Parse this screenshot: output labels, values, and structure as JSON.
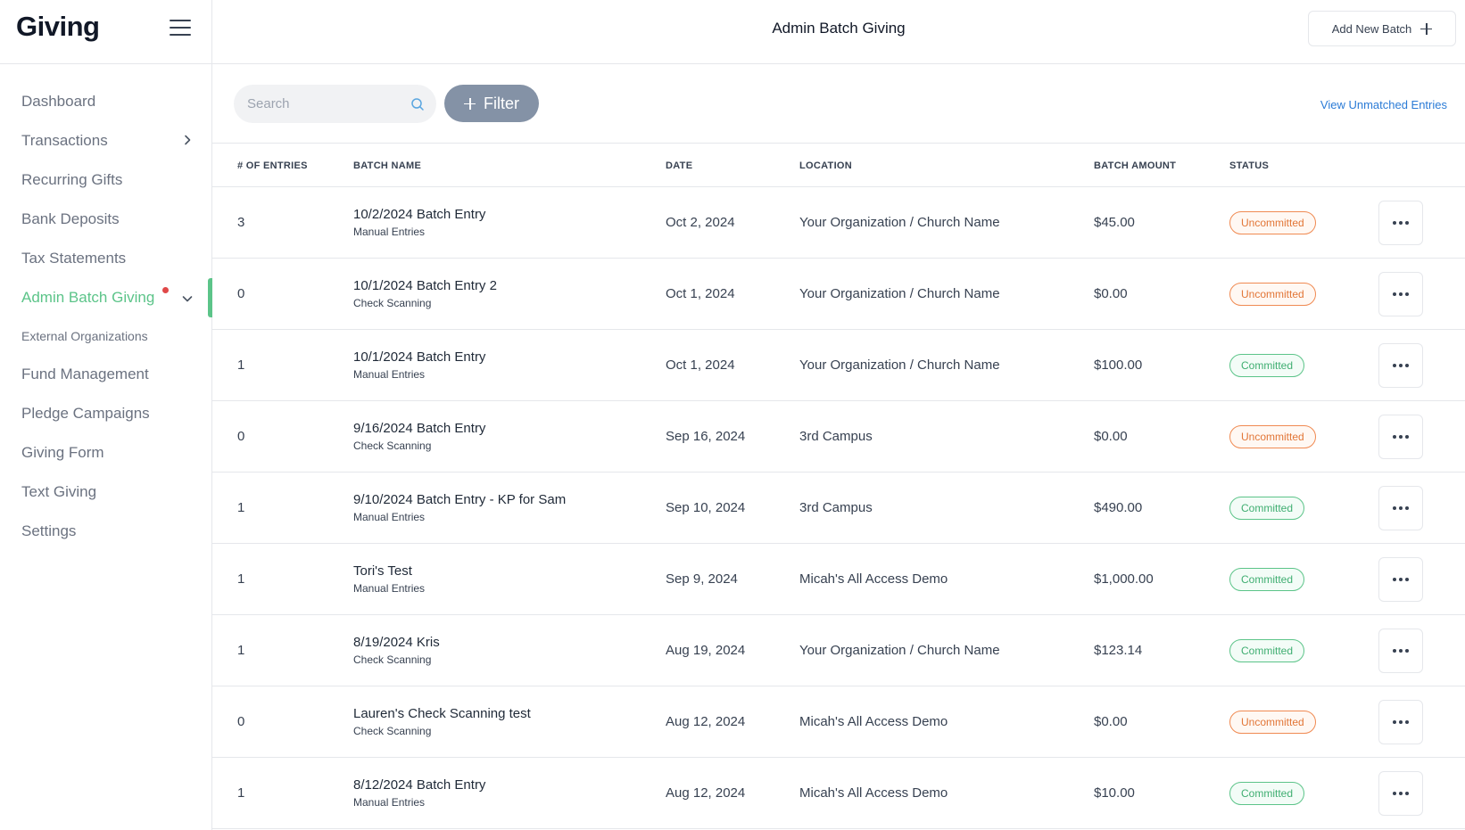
{
  "sidebar": {
    "brand": "Giving",
    "items": [
      {
        "label": "Dashboard"
      },
      {
        "label": "Transactions"
      },
      {
        "label": "Recurring Gifts"
      },
      {
        "label": "Bank Deposits"
      },
      {
        "label": "Tax Statements"
      },
      {
        "label": "Admin Batch Giving"
      },
      {
        "label": "External Organizations"
      },
      {
        "label": "Fund Management"
      },
      {
        "label": "Pledge Campaigns"
      },
      {
        "label": "Giving Form"
      },
      {
        "label": "Text Giving"
      },
      {
        "label": "Settings"
      }
    ]
  },
  "header": {
    "title": "Admin Batch Giving",
    "add_button": "Add New Batch"
  },
  "toolbar": {
    "search_placeholder": "Search",
    "filter_label": "Filter",
    "unmatched_link": "View Unmatched Entries"
  },
  "table": {
    "columns": [
      "# OF ENTRIES",
      "BATCH NAME",
      "DATE",
      "LOCATION",
      "BATCH AMOUNT",
      "STATUS"
    ],
    "rows": [
      {
        "entries": "3",
        "name": "10/2/2024 Batch Entry",
        "type": "Manual Entries",
        "date": "Oct 2, 2024",
        "location": "Your Organization / Church Name",
        "amount": "$45.00",
        "status": "Uncommitted"
      },
      {
        "entries": "0",
        "name": "10/1/2024 Batch Entry 2",
        "type": "Check Scanning",
        "date": "Oct 1, 2024",
        "location": "Your Organization / Church Name",
        "amount": "$0.00",
        "status": "Uncommitted"
      },
      {
        "entries": "1",
        "name": "10/1/2024 Batch Entry",
        "type": "Manual Entries",
        "date": "Oct 1, 2024",
        "location": "Your Organization / Church Name",
        "amount": "$100.00",
        "status": "Committed"
      },
      {
        "entries": "0",
        "name": "9/16/2024 Batch Entry",
        "type": "Check Scanning",
        "date": "Sep 16, 2024",
        "location": "3rd Campus",
        "amount": "$0.00",
        "status": "Uncommitted"
      },
      {
        "entries": "1",
        "name": "9/10/2024 Batch Entry - KP for Sam",
        "type": "Manual Entries",
        "date": "Sep 10, 2024",
        "location": "3rd Campus",
        "amount": "$490.00",
        "status": "Committed"
      },
      {
        "entries": "1",
        "name": "Tori's Test",
        "type": "Manual Entries",
        "date": "Sep 9, 2024",
        "location": "Micah's All Access Demo",
        "amount": "$1,000.00",
        "status": "Committed"
      },
      {
        "entries": "1",
        "name": "8/19/2024 Kris",
        "type": "Check Scanning",
        "date": "Aug 19, 2024",
        "location": "Your Organization / Church Name",
        "amount": "$123.14",
        "status": "Committed"
      },
      {
        "entries": "0",
        "name": "Lauren's Check Scanning test",
        "type": "Check Scanning",
        "date": "Aug 12, 2024",
        "location": "Micah's All Access Demo",
        "amount": "$0.00",
        "status": "Uncommitted"
      },
      {
        "entries": "1",
        "name": "8/12/2024 Batch Entry",
        "type": "Manual Entries",
        "date": "Aug 12, 2024",
        "location": "Micah's All Access Demo",
        "amount": "$10.00",
        "status": "Committed"
      }
    ]
  },
  "colors": {
    "accent": "#5cc489",
    "uncommitted": "#e27637",
    "committed": "#3fae71",
    "filter_button": "#8492a6",
    "link": "#2b7bd6",
    "notification_dot": "#e04848"
  },
  "icons": {
    "menu": "hamburger-icon",
    "expand": "chevron-right-icon",
    "collapse": "chevron-down-icon",
    "search": "search-icon",
    "add": "plus-icon",
    "row_actions": "more-horizontal-icon"
  }
}
